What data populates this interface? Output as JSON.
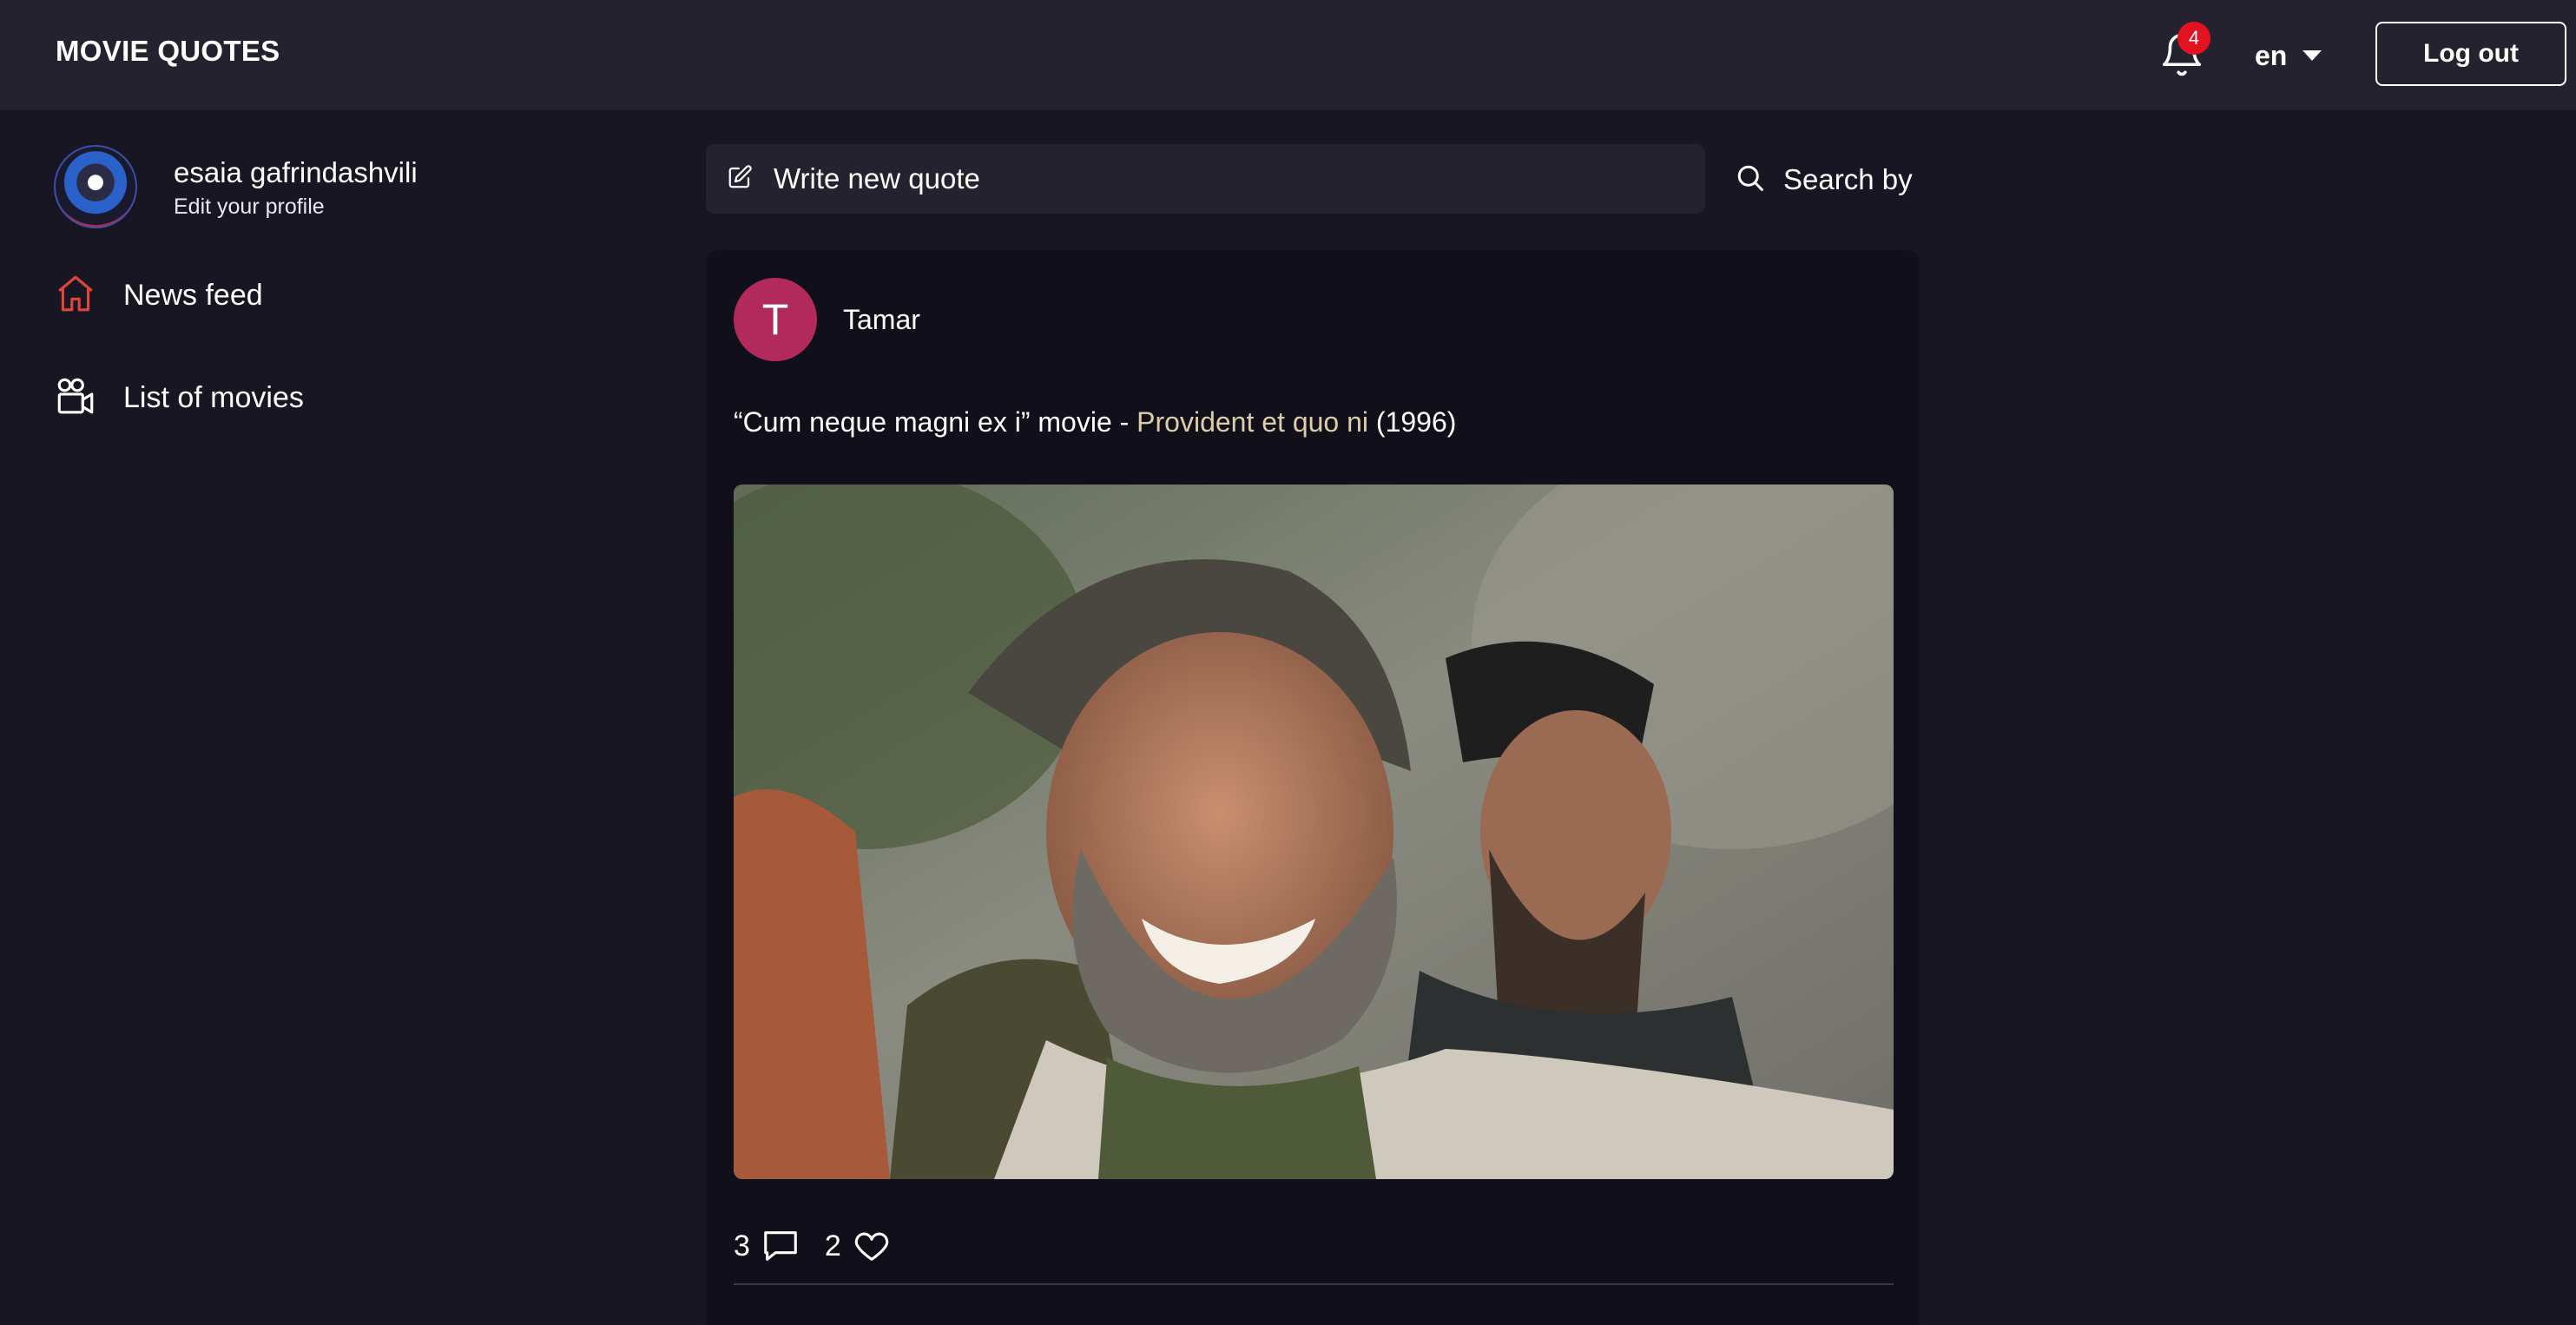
{
  "header": {
    "brand": "MOVIE QUOTES",
    "notifications_count": "4",
    "language": "en",
    "logout_label": "Log out"
  },
  "profile": {
    "name": "esaia gafrindashvili",
    "edit_label": "Edit your profile"
  },
  "nav": {
    "items": [
      {
        "label": "News feed",
        "icon": "home-icon",
        "active": true
      },
      {
        "label": "List of movies",
        "icon": "movie-camera-icon",
        "active": false
      }
    ]
  },
  "compose": {
    "label": "Write new quote",
    "icon": "pencil-icon"
  },
  "search": {
    "label": "Search by",
    "icon": "search-icon"
  },
  "post": {
    "author_initial": "T",
    "author_name": "Tamar",
    "quote_prefix": "“Cum neque magni ex i” movie - ",
    "movie_title": "Provident et quo ni",
    "year_text": " (1996)",
    "comments_count": "3",
    "likes_count": "2"
  },
  "colors": {
    "background": "#181623",
    "header": "#24222f",
    "accent_red": "#e31221",
    "movie_title": "#ddccaa",
    "author_avatar": "#b22a5b",
    "home_icon_active": "#e0453b"
  }
}
